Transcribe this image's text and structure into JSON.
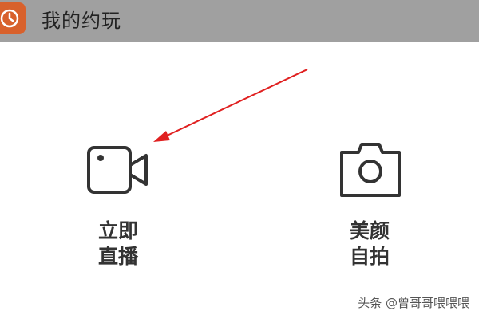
{
  "header": {
    "app_icon": "clock-icon",
    "title": "我的约玩"
  },
  "actions": [
    {
      "icon": "video-camera-icon",
      "label_line1": "立即",
      "label_line2": "直播"
    },
    {
      "icon": "camera-icon",
      "label_line1": "美颜",
      "label_line2": "自拍"
    }
  ],
  "annotation": {
    "arrow_color": "#e02020"
  },
  "watermark": "头条 @曾哥哥喂喂喂",
  "colors": {
    "header_bg": "#a0a0a0",
    "app_icon_bg": "#d8612c",
    "icon_stroke": "#333333"
  }
}
